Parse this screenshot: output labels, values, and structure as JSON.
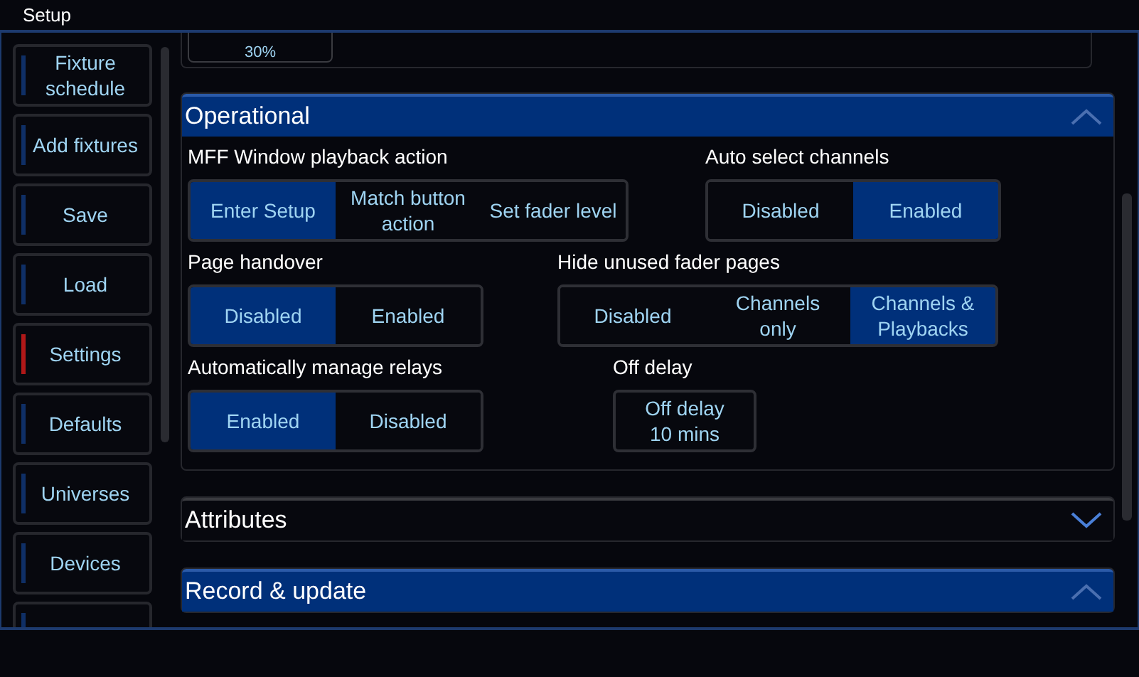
{
  "window": {
    "title": "Setup"
  },
  "sidebar": {
    "items": [
      {
        "label": "Fixture schedule",
        "selected": false
      },
      {
        "label": "Add fixtures",
        "selected": false
      },
      {
        "label": "Save",
        "selected": false
      },
      {
        "label": "Load",
        "selected": false
      },
      {
        "label": "Settings",
        "selected": true
      },
      {
        "label": "Defaults",
        "selected": false
      },
      {
        "label": "Universes",
        "selected": false
      },
      {
        "label": "Devices",
        "selected": false
      },
      {
        "selected": false
      }
    ]
  },
  "previous_value": "30%",
  "sections": [
    {
      "title": "Operational",
      "expanded": true,
      "rows": [
        [
          {
            "kind": "segmented",
            "label": "MFF Window playback action",
            "options": [
              {
                "label": "Enter Setup",
                "selected": true
              },
              {
                "label": "Match button action",
                "selected": false
              },
              {
                "label": "Set fader level",
                "selected": false
              }
            ]
          },
          {
            "kind": "segmented",
            "label": "Auto select channels",
            "options": [
              {
                "label": "Disabled",
                "selected": false
              },
              {
                "label": "Enabled",
                "selected": true
              }
            ]
          }
        ],
        [
          {
            "kind": "segmented",
            "label": "Page handover",
            "options": [
              {
                "label": "Disabled",
                "selected": true
              },
              {
                "label": "Enabled",
                "selected": false
              }
            ]
          },
          {
            "kind": "segmented",
            "label": "Hide unused fader pages",
            "options": [
              {
                "label": "Disabled",
                "selected": false
              },
              {
                "label": "Channels only",
                "selected": false
              },
              {
                "label": "Channels & Playbacks",
                "selected": true
              }
            ]
          }
        ],
        [
          {
            "kind": "segmented",
            "label": "Automatically manage relays",
            "options": [
              {
                "label": "Enabled",
                "selected": true
              },
              {
                "label": "Disabled",
                "selected": false
              }
            ]
          },
          {
            "kind": "value",
            "label": "Off delay",
            "value": "Off delay 10 mins"
          }
        ]
      ]
    },
    {
      "title": "Attributes",
      "expanded": false
    },
    {
      "title": "Record & update",
      "expanded": true
    }
  ]
}
